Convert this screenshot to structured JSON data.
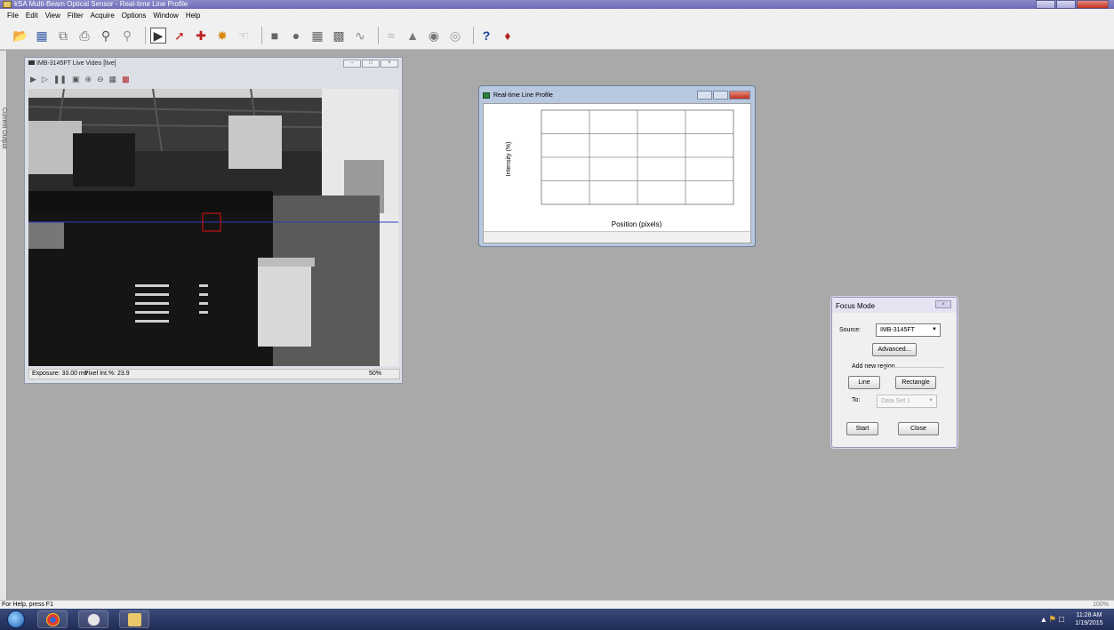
{
  "app": {
    "title": "kSA Multi-Beam Optical Sensor - Real-time Line Profile"
  },
  "menu": [
    "File",
    "Edit",
    "View",
    "Filter",
    "Acquire",
    "Options",
    "Window",
    "Help"
  ],
  "toolbar": {
    "icons": [
      "open-folder-icon",
      "save-icon",
      "copy-icon",
      "print-icon",
      "zoom-in-icon",
      "zoom-out-icon",
      "live-video-icon",
      "laser-icon",
      "alignment-icon",
      "target-icon",
      "pointer-icon",
      "square-icon",
      "circle-icon",
      "grid-icon",
      "pattern-icon",
      "wave-icon",
      "stage-icon",
      "camera-icon",
      "focus-icon",
      "scan-icon",
      "help-icon",
      "about-icon"
    ]
  },
  "side_tab": {
    "label": "Current Output"
  },
  "live_video": {
    "title": "IMB-3145FT Live Video [live]",
    "exposure": "Exposure: 33.00 ms",
    "pixel_intensity": "Pixel Int.%: 23.9",
    "zoom": "50%"
  },
  "profile_window": {
    "title": "Real-time Line Profile",
    "ylabel": "Intensity (%)",
    "xlabel": "Position (pixels)"
  },
  "focus_mode": {
    "title": "Focus Mode",
    "source_label": "Source:",
    "source_value": "IMB-3145FT",
    "advanced_button": "Advanced...",
    "add_region_label": "Add new region",
    "line_button": "Line",
    "rectangle_button": "Rectangle",
    "to_label": "To:",
    "to_value": "Data Set 1",
    "start_button": "Start",
    "close_button": "Close"
  },
  "status": {
    "help_text": "For Help, press F1",
    "zoom": "100%"
  },
  "tray": {
    "time": "11:28 AM",
    "date": "1/19/2015"
  },
  "chart_data": {
    "type": "line",
    "title": "",
    "xlabel": "Position (pixels)",
    "ylabel": "Intensity (%)",
    "series": [],
    "grid": true
  }
}
